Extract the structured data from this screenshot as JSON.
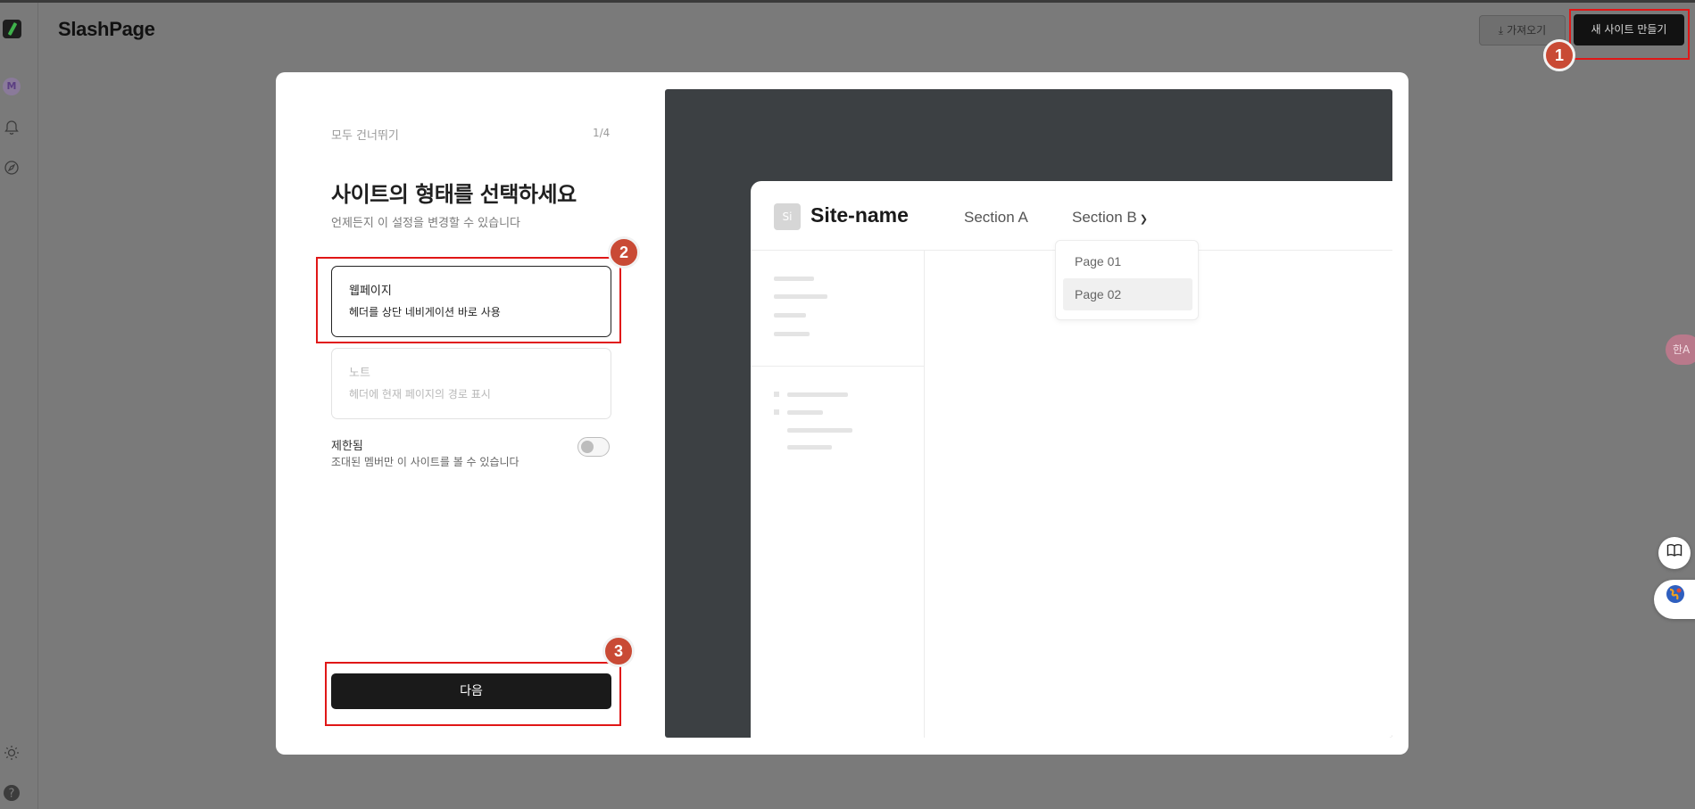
{
  "app": {
    "brand": "SlashPage"
  },
  "rail": {
    "avatar_letter": "M",
    "icons": [
      "logo-icon",
      "bell-icon",
      "compass-icon",
      "sun-icon",
      "help-icon"
    ]
  },
  "header": {
    "import_label": "가져오기",
    "new_site_label": "새 사이트 만들기"
  },
  "annotations": [
    "1",
    "2",
    "3"
  ],
  "modal": {
    "skip_label": "모두 건너뛰기",
    "step": "1/4",
    "title": "사이트의 형태를 선택하세요",
    "subtitle": "언제든지 이 설정을 변경할 수 있습니다",
    "options": [
      {
        "name": "웹페이지",
        "desc": "헤더를 상단 네비게이션 바로 사용",
        "selected": true
      },
      {
        "name": "노트",
        "desc": "헤더에 현재 페이지의 경로 표시",
        "selected": false
      }
    ],
    "restrict": {
      "label": "제한됨",
      "desc": "조대된 멤버만 이 사이트를 볼 수 있습니다",
      "enabled": false
    },
    "next_label": "다음"
  },
  "preview": {
    "logo_text": "Si",
    "site_name": "Site-name",
    "section_a": "Section A",
    "section_b": "Section B",
    "dropdown": [
      "Page 01",
      "Page 02"
    ]
  },
  "floating": {
    "translate_label": "한A"
  },
  "colors": {
    "highlight": "#e01717",
    "badge": "#c94a35",
    "preview_bg": "#3c4043"
  }
}
